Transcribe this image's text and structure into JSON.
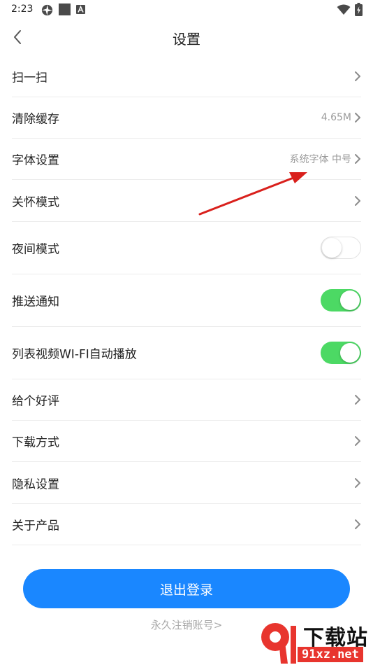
{
  "status_bar": {
    "time": "2:23"
  },
  "header": {
    "title": "设置"
  },
  "settings": [
    {
      "key": "scan",
      "label": "扫一扫",
      "value": "",
      "control": "chevron"
    },
    {
      "key": "clear-cache",
      "label": "清除缓存",
      "value": "4.65M",
      "control": "chevron"
    },
    {
      "key": "font",
      "label": "字体设置",
      "value": "系统字体 中号",
      "control": "chevron"
    },
    {
      "key": "care-mode",
      "label": "关怀模式",
      "value": "",
      "control": "chevron"
    },
    {
      "key": "night-mode",
      "label": "夜间模式",
      "value": "",
      "control": "toggle",
      "on": false
    },
    {
      "key": "push",
      "label": "推送通知",
      "value": "",
      "control": "toggle",
      "on": true
    },
    {
      "key": "wifi-autoplay",
      "label": "列表视频WI-FI自动播放",
      "value": "",
      "control": "toggle",
      "on": true
    },
    {
      "key": "rate",
      "label": "给个好评",
      "value": "",
      "control": "chevron"
    },
    {
      "key": "download-method",
      "label": "下载方式",
      "value": "",
      "control": "chevron"
    },
    {
      "key": "privacy",
      "label": "隐私设置",
      "value": "",
      "control": "chevron"
    },
    {
      "key": "about",
      "label": "关于产品",
      "value": "",
      "control": "chevron"
    }
  ],
  "actions": {
    "logout_label": "退出登录",
    "deactivate_label": "永久注销账号>"
  },
  "watermark": {
    "top": "下载站",
    "bottom": "91xz.net"
  },
  "colors": {
    "accent": "#1a87ff",
    "toggle_on": "#4cd964",
    "annotation_arrow": "#d9201c",
    "watermark_red": "#e8352e"
  }
}
